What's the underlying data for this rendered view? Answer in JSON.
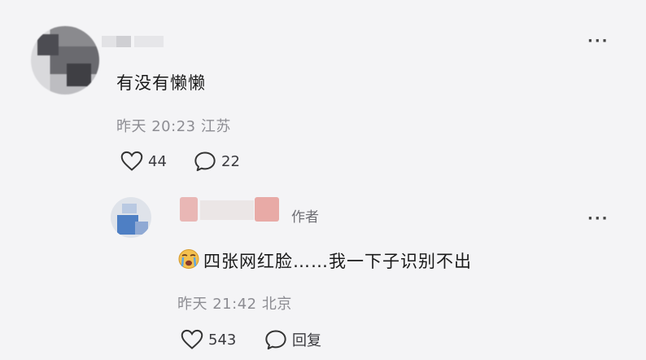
{
  "comments": [
    {
      "text": "有没有懒懒",
      "time": "昨天 20:23",
      "location": "江苏",
      "likes": "44",
      "replies": "22"
    },
    {
      "author_badge": "作者",
      "text": "四张网红脸……我一下子识别不出",
      "time": "昨天 21:42",
      "location": "北京",
      "likes": "543",
      "reply_label": "回复"
    }
  ],
  "icons": {
    "like": "heart-outline-icon",
    "comment": "speech-bubble-icon",
    "more": "ellipsis-icon",
    "emoji": "crying-face-emoji"
  },
  "colors": {
    "background": "#f4f4f6",
    "text": "#1a1a1a",
    "meta": "#8d8d93"
  }
}
